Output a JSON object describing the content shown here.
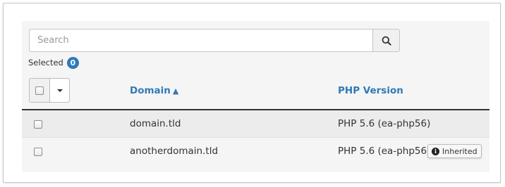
{
  "search": {
    "placeholder": "Search",
    "value": ""
  },
  "selection": {
    "label": "Selected",
    "count": "0"
  },
  "table": {
    "columns": [
      {
        "label": "Domain",
        "sort_indicator": "▲"
      },
      {
        "label": "PHP Version"
      }
    ],
    "rows": [
      {
        "domain": "domain.tld",
        "php_version": "PHP 5.6 (ea-php56)",
        "inherited": ""
      },
      {
        "domain": "anotherdomain.tld",
        "php_version": "PHP 5.6 (ea-php56)",
        "inherited": "Inherited"
      }
    ]
  },
  "icons": {
    "search": "search-icon",
    "info": "info-icon",
    "caret": "chevron-down-icon"
  },
  "colors": {
    "link": "#2f7ab8",
    "badge": "#2f7ab8",
    "header_border": "#333333"
  }
}
